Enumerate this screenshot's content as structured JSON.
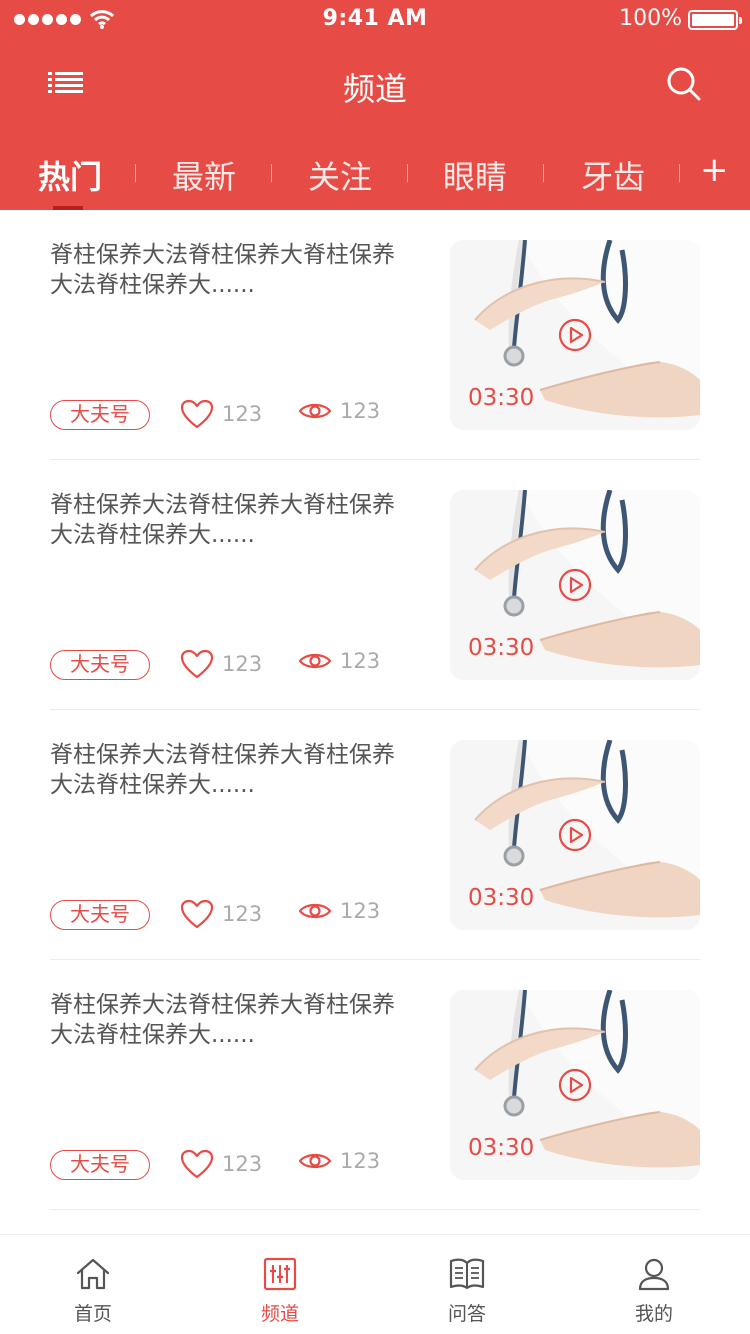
{
  "status_bar": {
    "time": "9:41 AM",
    "battery": "100%"
  },
  "nav": {
    "title": "频道"
  },
  "tabs": [
    {
      "label": "热门"
    },
    {
      "label": "最新"
    },
    {
      "label": "关注"
    },
    {
      "label": "眼睛"
    },
    {
      "label": "牙齿"
    }
  ],
  "tabs_add": "+",
  "cards": [
    {
      "title": "脊柱保养大法脊柱保养大脊柱保养大法脊柱保养大......",
      "tag": "大夫号",
      "likes": "123",
      "views": "123",
      "duration": "03:30"
    },
    {
      "title": "脊柱保养大法脊柱保养大脊柱保养大法脊柱保养大......",
      "tag": "大夫号",
      "likes": "123",
      "views": "123",
      "duration": "03:30"
    },
    {
      "title": "脊柱保养大法脊柱保养大脊柱保养大法脊柱保养大......",
      "tag": "大夫号",
      "likes": "123",
      "views": "123",
      "duration": "03:30"
    },
    {
      "title": "脊柱保养大法脊柱保养大脊柱保养大法脊柱保养大......",
      "tag": "大夫号",
      "likes": "123",
      "views": "123",
      "duration": "03:30"
    }
  ],
  "tabbar": [
    {
      "label": "首页",
      "icon": "home-icon"
    },
    {
      "label": "频道",
      "icon": "channel-icon"
    },
    {
      "label": "问答",
      "icon": "qa-icon"
    },
    {
      "label": "我的",
      "icon": "profile-icon"
    }
  ],
  "colors": {
    "brand": "#e64b45",
    "text": "#555555",
    "muted": "#aaaaaa"
  }
}
